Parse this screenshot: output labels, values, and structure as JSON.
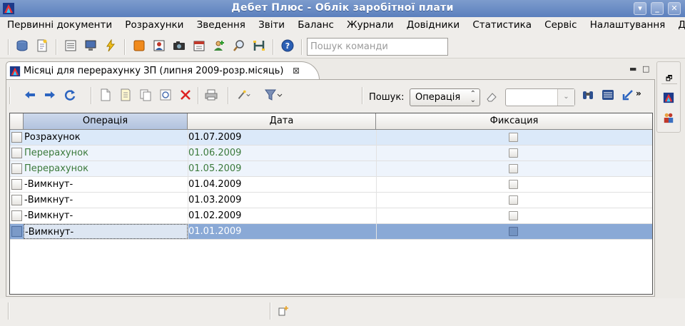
{
  "window": {
    "title": "Дебет Плюс - Облік заробітної плати"
  },
  "menu": [
    "Первинні документи",
    "Розрахунки",
    "Зведення",
    "Звіти",
    "Баланс",
    "Журнали",
    "Довідники",
    "Статистика",
    "Сервіс",
    "Налаштування",
    "Довідка"
  ],
  "toolbar": {
    "command_placeholder": "Пошук команди"
  },
  "editor": {
    "tab_label": "Місяці для перерахунку ЗП (липня 2009-розр.місяць)",
    "search_label": "Пошук:",
    "search_field": "Операція"
  },
  "table": {
    "columns": [
      "Операція",
      "Дата",
      "Фиксация"
    ],
    "rows": [
      {
        "operation": "Розрахунок",
        "date": "01.07.2009",
        "fixed": false
      },
      {
        "operation": "Перерахунок",
        "date": "01.06.2009",
        "fixed": false
      },
      {
        "operation": "Перерахунок",
        "date": "01.05.2009",
        "fixed": false
      },
      {
        "operation": "-Вимкнут-",
        "date": "01.04.2009",
        "fixed": false
      },
      {
        "operation": "-Вимкнут-",
        "date": "01.03.2009",
        "fixed": false
      },
      {
        "operation": "-Вимкнут-",
        "date": "01.02.2009",
        "fixed": false
      },
      {
        "operation": "-Вимкнут-",
        "date": "01.01.2009",
        "fixed": false
      }
    ]
  },
  "colors": {
    "selected_row": "#8aa9d6",
    "current_row": "#dbe9f9",
    "recalc_row": "#eef4fc",
    "recalc_text": "#3b7a3b",
    "title_bar": "#6b8cc6"
  },
  "icons": {
    "app": "app-logo-icon",
    "minimize": "minimize-icon",
    "maximize": "maximize-icon",
    "close": "close-icon"
  }
}
